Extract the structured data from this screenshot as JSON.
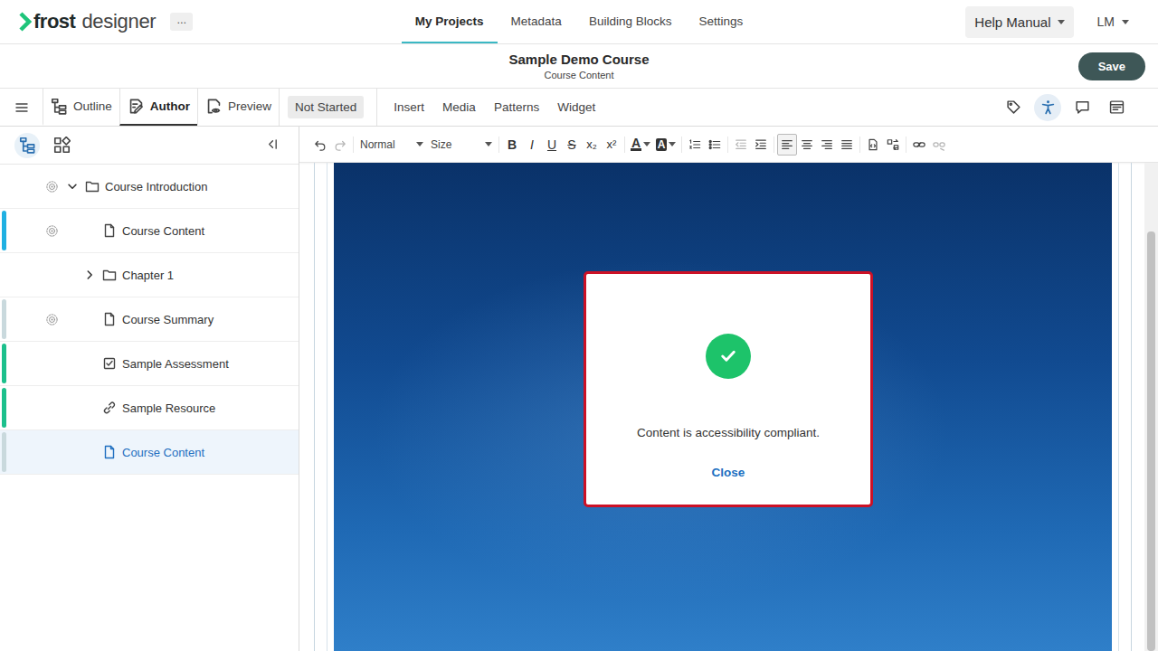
{
  "header": {
    "logo": {
      "bold": "frost",
      "light": "designer"
    },
    "more": "...",
    "nav": [
      {
        "label": "My Projects",
        "selected": true
      },
      {
        "label": "Metadata",
        "selected": false
      },
      {
        "label": "Building Blocks",
        "selected": false
      },
      {
        "label": "Settings",
        "selected": false
      }
    ],
    "help": "Help Manual",
    "user": "LM"
  },
  "course": {
    "title": "Sample Demo Course",
    "subtitle": "Course Content",
    "save": "Save"
  },
  "modes": [
    {
      "label": "Outline",
      "selected": false
    },
    {
      "label": "Author",
      "selected": true
    },
    {
      "label": "Preview",
      "selected": false
    }
  ],
  "status": "Not Started",
  "menu": [
    "Insert",
    "Media",
    "Patterns",
    "Widget"
  ],
  "tools": [
    {
      "active": false
    },
    {
      "active": true
    },
    {
      "active": false
    },
    {
      "active": false
    }
  ],
  "sidebar": {
    "views": [
      {
        "selected": true
      },
      {
        "selected": false
      }
    ],
    "items": [
      {
        "label": "Course Introduction",
        "kind": "folder",
        "level": 0,
        "expanded": true,
        "settings": true,
        "selected": false,
        "color": null
      },
      {
        "label": "Course Content",
        "kind": "page",
        "level": 1,
        "expanded": false,
        "settings": true,
        "selected": false,
        "color": "#1fb0e2"
      },
      {
        "label": "Chapter 1",
        "kind": "folder",
        "level": 1,
        "expanded": false,
        "settings": false,
        "selected": false,
        "color": null
      },
      {
        "label": "Course Summary",
        "kind": "page",
        "level": 1,
        "expanded": false,
        "settings": true,
        "selected": false,
        "color": "#c9d9dd"
      },
      {
        "label": "Sample Assessment",
        "kind": "assessment",
        "level": 1,
        "expanded": false,
        "settings": false,
        "selected": false,
        "color": "#1cc08c"
      },
      {
        "label": "Sample Resource",
        "kind": "resource",
        "level": 1,
        "expanded": false,
        "settings": false,
        "selected": false,
        "color": "#1cc08c"
      },
      {
        "label": "Course Content",
        "kind": "page",
        "level": 1,
        "expanded": false,
        "settings": false,
        "selected": true,
        "color": "#c9d9dd"
      }
    ]
  },
  "toolbar": {
    "format": "Normal",
    "size": "Size",
    "marks": [
      "B",
      "I",
      "U",
      "S",
      "x₂",
      "x²"
    ],
    "colors": [
      "A",
      "A"
    ],
    "icons": [
      {
        "disabled": false
      },
      {
        "disabled": true
      },
      {
        "disabled": false
      },
      {
        "disabled": false
      },
      {
        "disabled": true
      },
      {
        "disabled": false
      },
      {
        "disabled": false
      },
      {
        "disabled": false
      },
      {
        "disabled": false
      },
      {
        "disabled": true
      }
    ],
    "alignments": [
      {
        "selected": true
      },
      {
        "selected": false
      },
      {
        "selected": false
      },
      {
        "selected": false
      }
    ]
  },
  "modal": {
    "message": "Content is accessibility compliant.",
    "close": "Close"
  }
}
